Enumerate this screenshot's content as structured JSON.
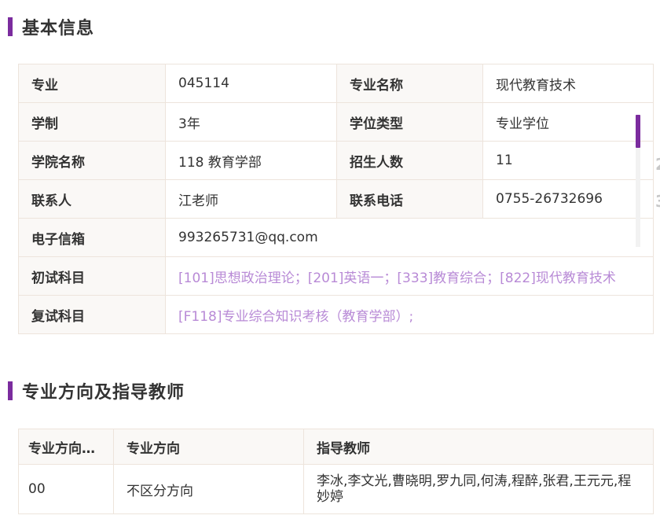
{
  "basic_info": {
    "title": "基本信息",
    "major_label": "专业",
    "major_code": "045114",
    "major_name_label": "专业名称",
    "major_name": "现代教育技术",
    "duration_label": "学制",
    "duration": "3年",
    "degree_type_label": "学位类型",
    "degree_type": "专业学位",
    "college_label": "学院名称",
    "college": "118 教育学部",
    "enrollment_label": "招生人数",
    "enrollment": "11",
    "contact_label": "联系人",
    "contact": "江老师",
    "phone_label": "联系电话",
    "phone": "0755-26732696",
    "email_label": "电子信箱",
    "email": "993265731@qq.com",
    "initial_exam_label": "初试科目",
    "initial_exam": "[101]思想政治理论；[201]英语一；[333]教育综合；[822]现代教育技术",
    "retest_label": "复试科目",
    "retest": "[F118]专业综合知识考核（教育学部）;"
  },
  "directions": {
    "title": "专业方向及指导教师",
    "headers": {
      "code": "专业方向代码",
      "direction": "专业方向",
      "advisors": "指导教师"
    },
    "rows": [
      {
        "code": "00",
        "direction": "不区分方向",
        "advisors": "李冰,李文光,曹晓明,罗九同,何涛,程醉,张君,王元元,程妙婷"
      }
    ]
  },
  "edge_digits": [
    "2",
    "3"
  ],
  "colors": {
    "accent": "#7b2c9e",
    "link": "#b88ad6",
    "label_bg": "#faf8f6",
    "border": "#ede4dc"
  }
}
